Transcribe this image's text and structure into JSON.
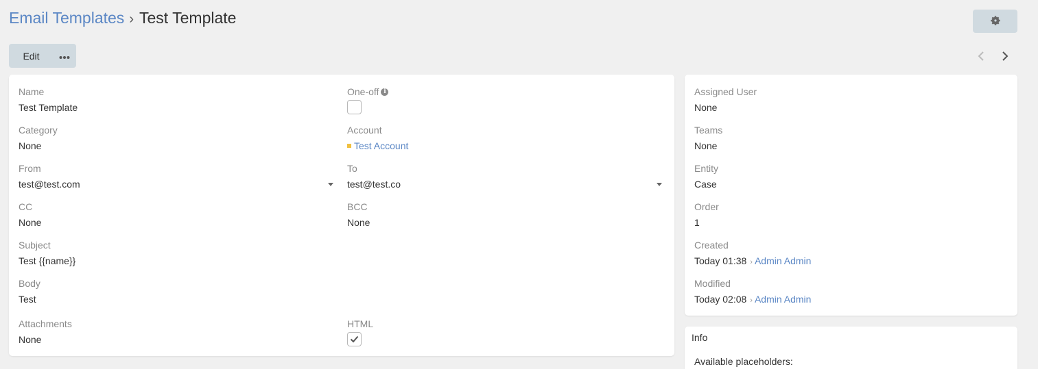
{
  "breadcrumb": {
    "parent": "Email Templates",
    "separator": "›",
    "current": "Test Template"
  },
  "toolbar": {
    "edit_label": "Edit",
    "more_icon": "ellipsis-icon",
    "settings_icon": "gear-icon"
  },
  "colors": {
    "link": "#5b87c5",
    "button_bg": "#d0dae0",
    "page_bg": "#f0f0f0",
    "label": "#8a8a8a",
    "account_marker": "#f0c040"
  },
  "main": {
    "name": {
      "label": "Name",
      "value": "Test Template"
    },
    "one_off": {
      "label": "One-off",
      "checked": false
    },
    "category": {
      "label": "Category",
      "value": "None"
    },
    "account": {
      "label": "Account",
      "value": "Test Account"
    },
    "from": {
      "label": "From",
      "value": "test@test.com"
    },
    "to": {
      "label": "To",
      "value": "test@test.co"
    },
    "cc": {
      "label": "CC",
      "value": "None"
    },
    "bcc": {
      "label": "BCC",
      "value": "None"
    },
    "subject": {
      "label": "Subject",
      "value": "Test {{name}}"
    },
    "body": {
      "label": "Body",
      "value": "Test"
    },
    "attachments": {
      "label": "Attachments",
      "value": "None"
    },
    "html": {
      "label": "HTML",
      "checked": true
    }
  },
  "side": {
    "assigned_user": {
      "label": "Assigned User",
      "value": "None"
    },
    "teams": {
      "label": "Teams",
      "value": "None"
    },
    "entity": {
      "label": "Entity",
      "value": "Case"
    },
    "order": {
      "label": "Order",
      "value": "1"
    },
    "created": {
      "label": "Created",
      "date": "Today 01:38",
      "separator": "›",
      "user": "Admin Admin"
    },
    "modified": {
      "label": "Modified",
      "date": "Today 02:08",
      "separator": "›",
      "user": "Admin Admin"
    }
  },
  "info": {
    "title": "Info",
    "text": "Available placeholders:"
  }
}
